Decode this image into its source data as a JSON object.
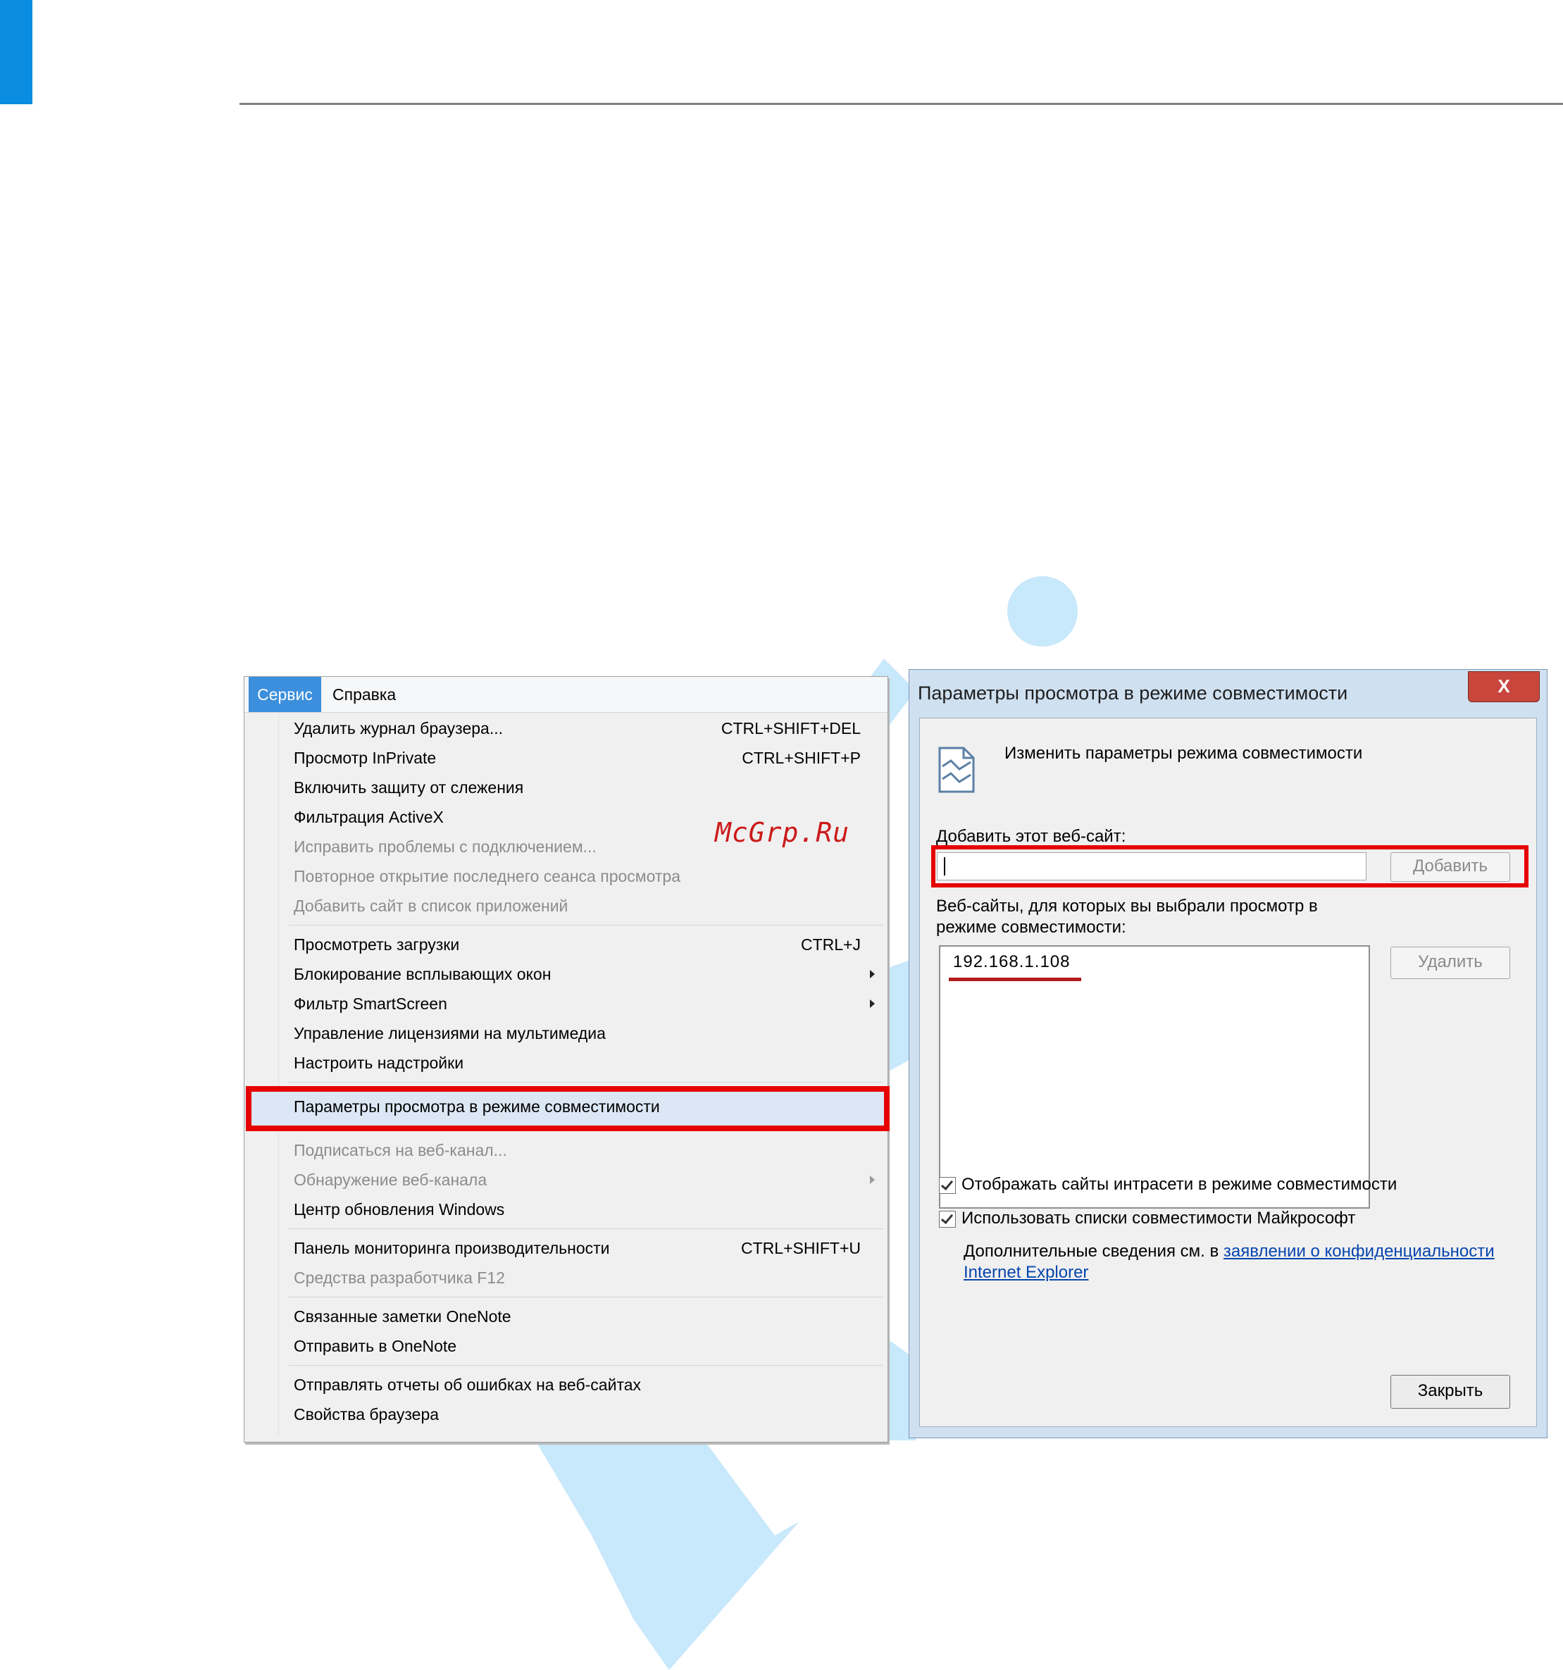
{
  "colors": {
    "accent": "#0a8de0",
    "watermark": "#c8e8fb",
    "highlight_border": "#e60000",
    "menubar_selected": "#3c8fdc"
  },
  "menu": {
    "bar": {
      "service": "Сервис",
      "help": "Справка"
    },
    "items": [
      {
        "label": "Удалить журнал браузера...",
        "shortcut": "CTRL+SHIFT+DEL",
        "enabled": true
      },
      {
        "label": "Просмотр InPrivate",
        "shortcut": "CTRL+SHIFT+P",
        "enabled": true
      },
      {
        "label": "Включить защиту от слежения",
        "enabled": true
      },
      {
        "label": "Фильтрация ActiveX",
        "enabled": true
      },
      {
        "label": "Исправить проблемы с подключением...",
        "enabled": false
      },
      {
        "label": "Повторное открытие последнего сеанса просмотра",
        "enabled": false
      },
      {
        "label": "Добавить сайт в список приложений",
        "enabled": false
      },
      {
        "separator": true
      },
      {
        "label": "Просмотреть загрузки",
        "shortcut": "CTRL+J",
        "enabled": true
      },
      {
        "label": "Блокирование всплывающих окон",
        "submenu": true,
        "enabled": true
      },
      {
        "label": "Фильтр SmartScreen",
        "submenu": true,
        "enabled": true
      },
      {
        "label": "Управление лицензиями на мультимедиа",
        "enabled": true
      },
      {
        "label": "Настроить надстройки",
        "enabled": true
      },
      {
        "separator": true
      },
      {
        "label": "Параметры просмотра в режиме совместимости",
        "enabled": true,
        "highlighted": true
      },
      {
        "separator": true
      },
      {
        "label": "Подписаться на веб-канал...",
        "enabled": false
      },
      {
        "label": "Обнаружение веб-канала",
        "submenu": true,
        "enabled": false
      },
      {
        "label": "Центр обновления Windows",
        "enabled": true
      },
      {
        "separator": true
      },
      {
        "label": "Панель мониторинга производительности",
        "shortcut": "CTRL+SHIFT+U",
        "enabled": true
      },
      {
        "label": "Средства разработчика F12",
        "enabled": false
      },
      {
        "separator": true
      },
      {
        "label": "Связанные заметки OneNote",
        "enabled": true
      },
      {
        "label": "Отправить в OneNote",
        "enabled": true
      },
      {
        "separator": true
      },
      {
        "label": "Отправлять отчеты об ошибках на веб-сайтах",
        "enabled": true
      },
      {
        "label": "Свойства браузера",
        "enabled": true
      }
    ]
  },
  "watermark_text": "McGrp.Ru",
  "dialog": {
    "title": "Параметры просмотра в режиме совместимости",
    "close_glyph": "X",
    "header_text": "Изменить параметры режима совместимости",
    "header_icon": "compat-settings-icon",
    "add_site_label": "Добавить этот веб-сайт:",
    "add_site_value": "",
    "add_button": "Добавить",
    "sites_label": "Веб-сайты, для которых вы выбрали просмотр в режиме совместимости:",
    "sites": [
      "192.168.1.108"
    ],
    "remove_button": "Удалить",
    "check_intranet": {
      "label": "Отображать сайты интрасети в режиме совместимости",
      "checked": true
    },
    "check_ms_lists": {
      "label": "Использовать списки совместимости Майкрософт",
      "checked": true
    },
    "privacy_prefix": "Дополнительные сведения см. в ",
    "privacy_link_1": "заявлении о конфиденциальности",
    "privacy_link_2": "Internet Explorer",
    "close_button": "Закрыть"
  }
}
